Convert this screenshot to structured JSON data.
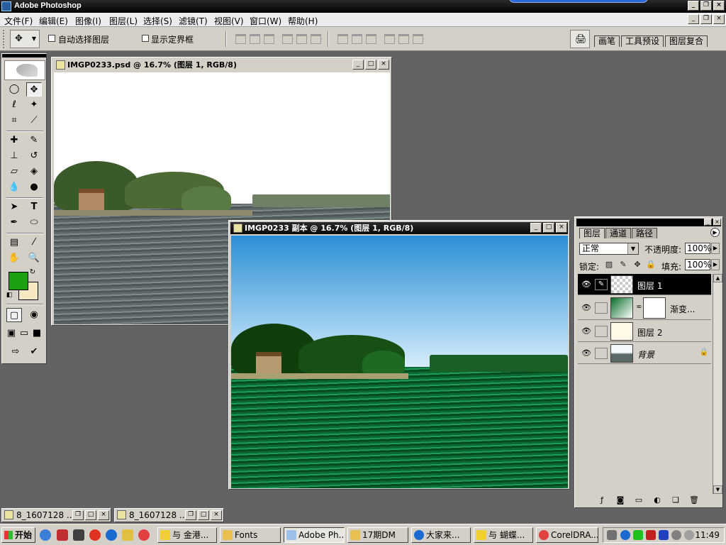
{
  "app": {
    "title": "Adobe Photoshop"
  },
  "menu": [
    "文件(F)",
    "编辑(E)",
    "图像(I)",
    "图层(L)",
    "选择(S)",
    "滤镜(T)",
    "视图(V)",
    "窗口(W)",
    "帮助(H)"
  ],
  "options": {
    "auto_select": "自动选择图层",
    "show_bounds": "显示定界框",
    "well_tabs": [
      "画笔",
      "工具预设",
      "图层复合"
    ]
  },
  "doc1": {
    "title": "IMGP0233.psd @ 16.7% (图层 1, RGB/8)"
  },
  "doc2": {
    "title": "IMGP0233 副本 @ 16.7% (图层 1, RGB/8)"
  },
  "layers": {
    "tabs": [
      "图层",
      "通道",
      "路径"
    ],
    "blend_mode": "正常",
    "opacity_label": "不透明度:",
    "opacity": "100%",
    "lock_label": "锁定:",
    "fill_label": "填充:",
    "fill": "100%",
    "items": [
      {
        "name": "图层 1"
      },
      {
        "name": "渐变..."
      },
      {
        "name": "图层 2"
      },
      {
        "name": "背景"
      }
    ]
  },
  "minimized": [
    "8_1607128 ...",
    "8_1607128 ..."
  ],
  "taskbar": {
    "start": "开始",
    "tasks": [
      "与 金港...",
      "Fonts",
      "Adobe Ph...",
      "17期DM",
      "大家来...",
      "与 蝴蝶...",
      "CorelDRA..."
    ],
    "clock": "11:49"
  },
  "colors": {
    "foreground": "#1aa012",
    "background": "#f6e9c2"
  }
}
